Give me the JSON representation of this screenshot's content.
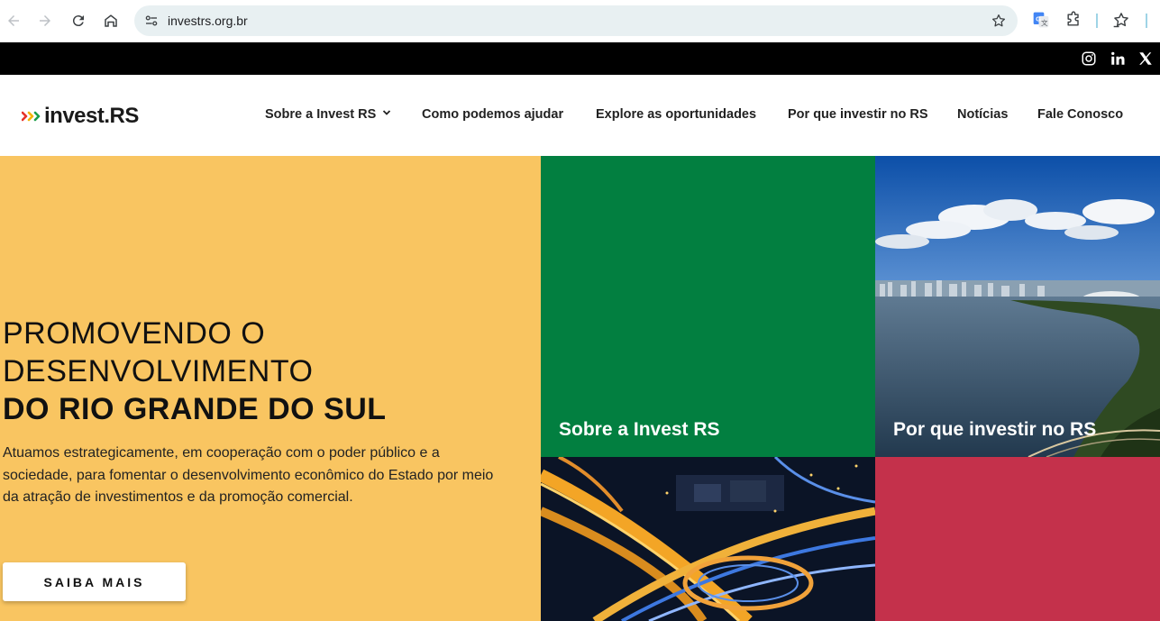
{
  "browser": {
    "url": "investrs.org.br",
    "icons": [
      "back-arrow-icon",
      "forward-arrow-icon",
      "reload-icon",
      "home-icon",
      "site-settings-icon",
      "bookmark-star-icon",
      "google-translate-icon",
      "extensions-puzzle-icon",
      "reading-list-icon"
    ]
  },
  "social": {
    "icons": [
      "instagram-icon",
      "linkedin-icon",
      "x-twitter-icon"
    ]
  },
  "header": {
    "logo_text": "invest.RS",
    "nav": [
      {
        "label": "Sobre a Invest RS",
        "has_dropdown": true
      },
      {
        "label": "Como podemos ajudar"
      },
      {
        "label": "Explore as oportunidades"
      },
      {
        "label": "Por que investir no RS"
      },
      {
        "label": "Notícias"
      },
      {
        "label": "Fale Conosco"
      }
    ]
  },
  "hero": {
    "title_line1": "PROMOVENDO O",
    "title_line2": "DESENVOLVIMENTO",
    "title_line3": "DO RIO GRANDE DO SUL",
    "description": "Atuamos estrategicamente, em cooperação com o poder público e a sociedade, para fomentar o desenvolvimento econômico do Estado por meio da atração de investimentos e da promoção comercial.",
    "cta_label": "SAIBA MAIS",
    "background_color": "#f9c561"
  },
  "tiles": [
    {
      "label": "Sobre a Invest RS",
      "color": "#027f40"
    },
    {
      "label": "Por que investir no RS",
      "color": "#1d5ea8"
    },
    {
      "label": "",
      "color": "#0b1426"
    },
    {
      "label": "",
      "color": "#c4314b"
    }
  ],
  "colors": {
    "logo_chevron_1": "#e6332a",
    "logo_chevron_2": "#f4b400",
    "logo_chevron_3": "#1b9e4b"
  }
}
